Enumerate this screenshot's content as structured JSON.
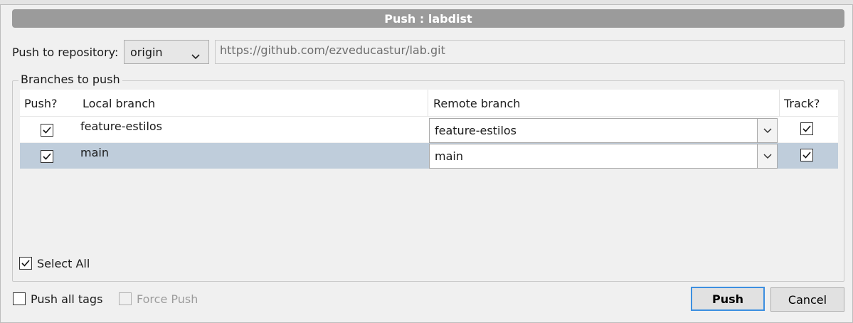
{
  "dialog": {
    "title": "Push :  labdist",
    "repo_label": "Push to repository:",
    "repo_selected": "origin",
    "repo_url": "https://github.com/ezveducastur/lab.git",
    "branches_group_label": "Branches to push",
    "columns": {
      "push": "Push?",
      "local": "Local branch",
      "remote": "Remote branch",
      "track": "Track?"
    },
    "rows": [
      {
        "local": "feature-estilos",
        "remote": "feature-estilos",
        "push": true,
        "track": true
      },
      {
        "local": "main",
        "remote": "main",
        "push": true,
        "track": true
      }
    ],
    "select_all_label": "Select All",
    "push_all_tags_label": "Push all tags",
    "force_push_label": "Force Push",
    "push_button": "Push",
    "cancel_button": "Cancel"
  },
  "colors": {
    "titlebar": "#9b9b9b",
    "selected_row": "#bfcddb",
    "default_button_border": "#3c8fe0"
  },
  "icons": [
    "chevron-down-icon",
    "checkmark-icon"
  ]
}
